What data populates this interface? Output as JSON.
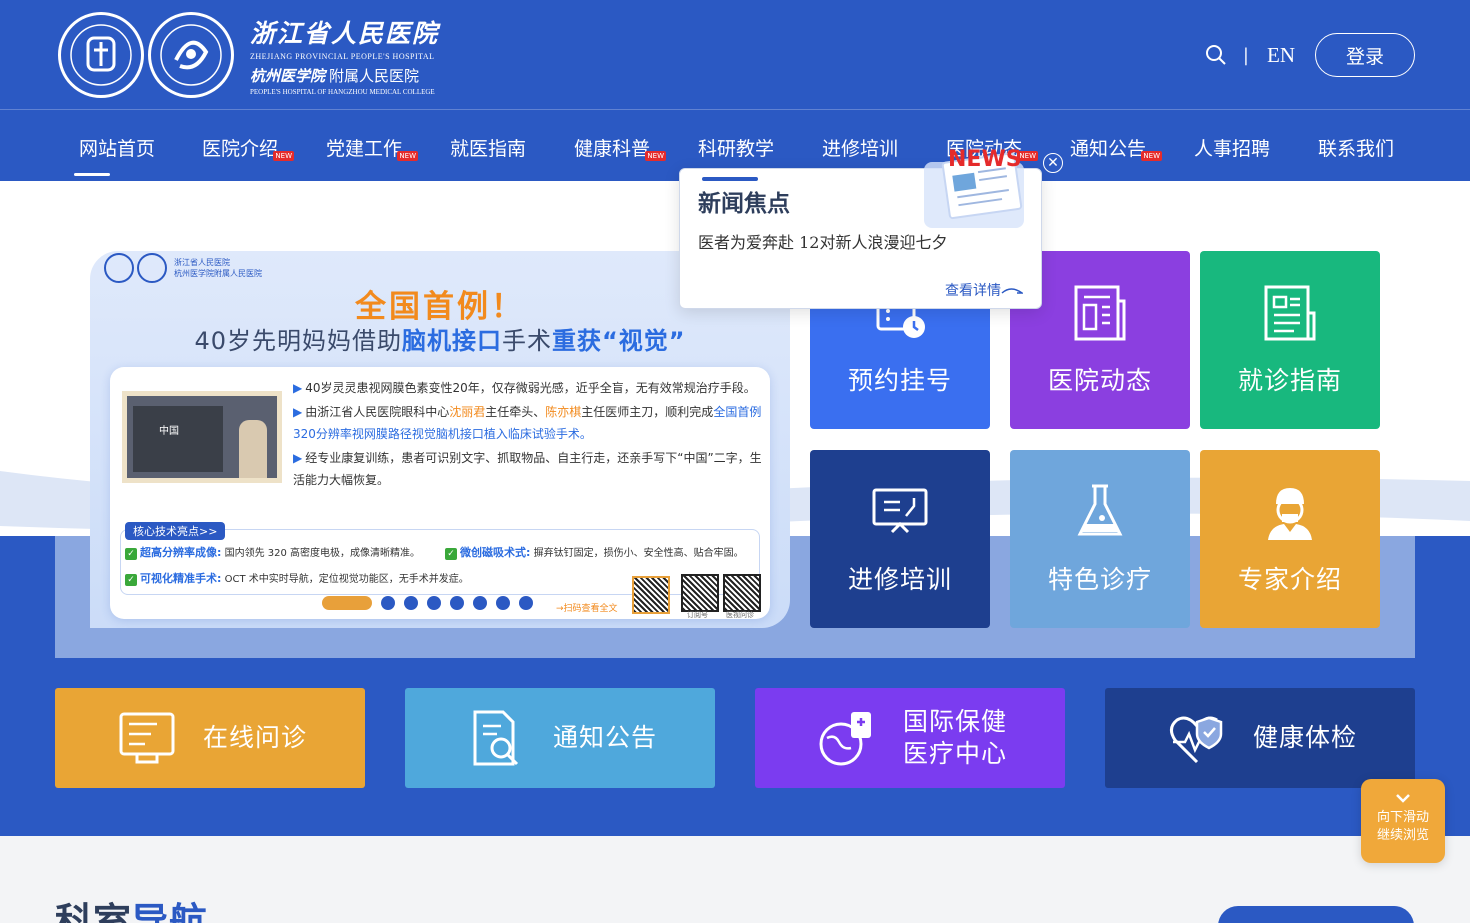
{
  "header": {
    "logo": {
      "name_cn": "浙江省人民医院",
      "name_en": "ZHEJIANG PROVINCIAL PEOPLE'S HOSPITAL",
      "sub_cn_a": "杭州医学院",
      "sub_cn_b": "附属人民医院",
      "sub_en": "PEOPLE'S HOSPITAL OF HANGZHOU MEDICAL COLLEGE"
    },
    "search_icon": "search-icon",
    "separator": "|",
    "language": "EN",
    "login_label": "登录"
  },
  "nav": {
    "items": [
      {
        "label": "网站首页",
        "new": false,
        "active": true
      },
      {
        "label": "医院介绍",
        "new": true
      },
      {
        "label": "党建工作",
        "new": true
      },
      {
        "label": "就医指南",
        "new": false
      },
      {
        "label": "健康科普",
        "new": true
      },
      {
        "label": "科研教学",
        "new": false
      },
      {
        "label": "进修培训",
        "new": false
      },
      {
        "label": "医院动态",
        "new": true
      },
      {
        "label": "通知公告",
        "new": true
      },
      {
        "label": "人事招聘",
        "new": false
      },
      {
        "label": "联系我们",
        "new": false
      }
    ],
    "new_badge": "NEW"
  },
  "banner": {
    "logo_line1": "浙江省人民医院",
    "logo_line2": "杭州医学院附属人民医院",
    "title1": "全国首例！",
    "title2_a": "40岁先明妈妈借助",
    "title2_b": "脑机接口",
    "title2_c": "手术",
    "title2_d": "重获“视觉”",
    "photo_label": "中国",
    "bullet1": "40岁灵灵患视网膜色素变性20年，仅存微弱光感，近乎全盲，无有效常规治疗手段。",
    "bullet2_a": "由浙江省人民医院眼科中心",
    "bullet2_b": "沈丽君",
    "bullet2_c": "主任牵头、",
    "bullet2_d": "陈亦棋",
    "bullet2_e": "主任医师主刀，顺利完成",
    "bullet2_f": "全国首例320分辨率视网膜路径视觉脑机接口植入临床试验手术。",
    "bullet3": "经专业康复训练，患者可识别文字、抓取物品、自主行走，还亲手写下“中国”二字，生活能力大幅恢复。",
    "tech_tag": "核心技术亮点>>",
    "tech1_title": "超高分辨率成像:",
    "tech1_desc": "国内领先 320 高密度电极，成像清晰精准。",
    "tech2_title": "微创磁吸术式:",
    "tech2_desc": "摒弃钛钉固定，损伤小、安全性高、贴合牢固。",
    "tech3_title": "可视化精准手术:",
    "tech3_desc": "OCT 术中实时导航，定位视觉功能区，无手术并发症。",
    "scan_label": "→扫码查看全文",
    "qr1_label": "订阅号",
    "qr2_label": "医视问诊",
    "slide_count": 8,
    "active_slide": 0
  },
  "tiles": [
    {
      "label": "预约挂号",
      "icon": "calendar-clock-icon",
      "color": "#3a6ff0"
    },
    {
      "label": "医院动态",
      "icon": "newspaper-icon",
      "color": "#8b3fe0"
    },
    {
      "label": "就诊指南",
      "icon": "guide-document-icon",
      "color": "#18b87e"
    },
    {
      "label": "进修培训",
      "icon": "presentation-board-icon",
      "color": "#1e3f8f"
    },
    {
      "label": "特色诊疗",
      "icon": "flask-icon",
      "color": "#6fa6dc"
    },
    {
      "label": "专家介绍",
      "icon": "doctor-icon",
      "color": "#e9a535"
    }
  ],
  "cards": [
    {
      "label1": "在线问诊",
      "label2": "",
      "icon": "online-consult-icon",
      "color": "#e9a535"
    },
    {
      "label1": "通知公告",
      "label2": "",
      "icon": "notice-search-icon",
      "color": "#4fa8dc"
    },
    {
      "label1": "国际保健",
      "label2": "医疗中心",
      "icon": "globe-medicine-icon",
      "color": "#7b3cf0"
    },
    {
      "label1": "健康体检",
      "label2": "",
      "icon": "heart-shield-icon",
      "color": "#1e3f8f"
    }
  ],
  "popup": {
    "title": "新闻焦点",
    "text": "医者为爱奔赴 12对新人浪漫迎七夕",
    "more": "查看详情",
    "badge": "NEWS",
    "close_icon": "close-circle-icon"
  },
  "scroll_hint": {
    "line1": "向下滑动",
    "line2": "继续浏览"
  },
  "section": {
    "title_a": "科室",
    "title_b": "导航"
  }
}
